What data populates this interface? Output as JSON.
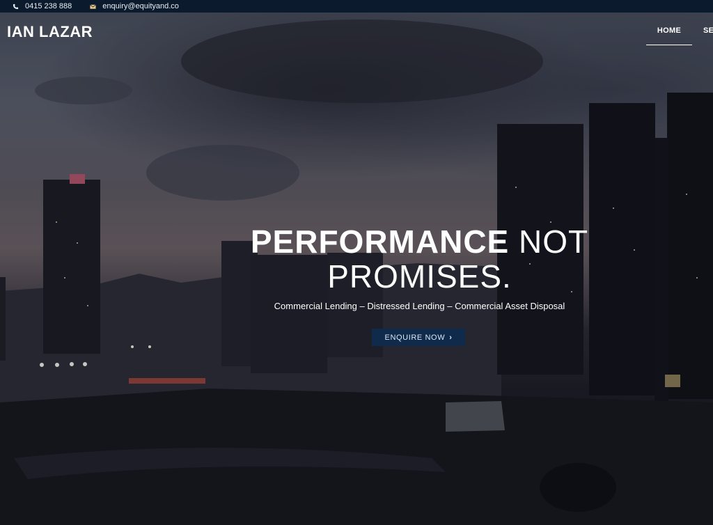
{
  "contact": {
    "phone": "0415 238 888",
    "email": "enquiry@equityand.co"
  },
  "brand": {
    "logo": "IAN LAZAR"
  },
  "nav": {
    "home": "HOME",
    "services": "SE"
  },
  "hero": {
    "headline_strong": "PERFORMANCE",
    "headline_rest": " NOT",
    "headline_line2": "PROMISES.",
    "subheadline": "Commercial Lending – Distressed Lending – Commercial Asset Disposal",
    "cta_label": "ENQUIRE NOW",
    "cta_icon": "›"
  },
  "icons": {
    "phone": "phone-icon",
    "email": "envelope-icon"
  },
  "colors": {
    "topbar": "#0b1a2c",
    "cta": "#0f2a4a"
  }
}
